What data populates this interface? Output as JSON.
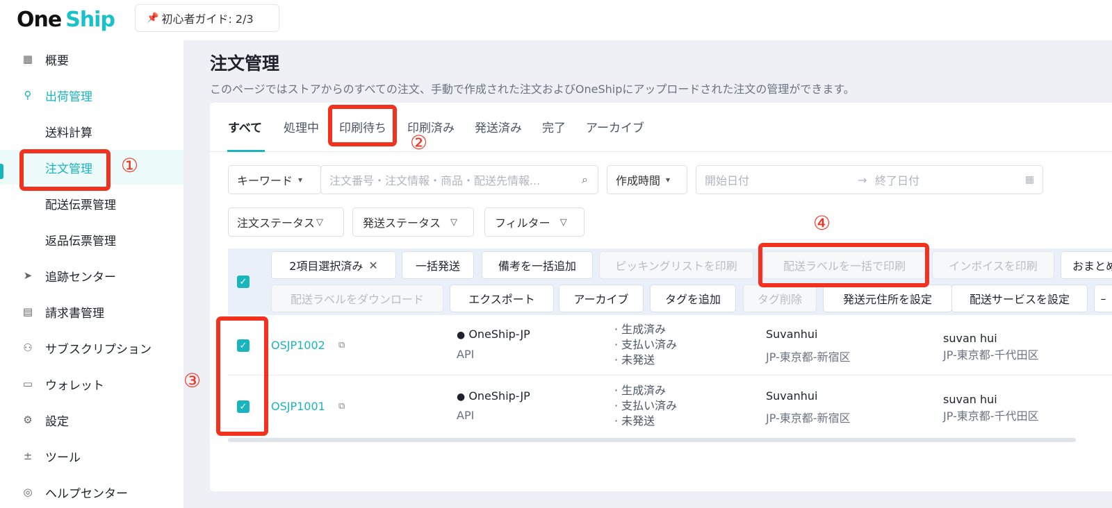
{
  "header": {
    "logo_one": "One",
    "logo_ship": "Ship",
    "guide_label": "初心者ガイド: 2/3"
  },
  "sidebar": {
    "items": [
      {
        "label": "概要",
        "icon": "grid-icon"
      },
      {
        "label": "出荷管理",
        "icon": "shipping-icon"
      },
      {
        "label": "送料計算"
      },
      {
        "label": "注文管理"
      },
      {
        "label": "配送伝票管理"
      },
      {
        "label": "返品伝票管理"
      },
      {
        "label": "追跡センター",
        "icon": "send-icon"
      },
      {
        "label": "請求書管理",
        "icon": "document-icon"
      },
      {
        "label": "サブスクリプション",
        "icon": "user-icon"
      },
      {
        "label": "ウォレット",
        "icon": "wallet-icon"
      },
      {
        "label": "設定",
        "icon": "gear-icon"
      },
      {
        "label": "ツール",
        "icon": "tools-icon"
      },
      {
        "label": "ヘルプセンター",
        "icon": "help-icon"
      }
    ]
  },
  "page": {
    "title": "注文管理",
    "description": "このページではストアからのすべての注文、手動で作成された注文およびOneShipにアップロードされた注文の管理ができます。"
  },
  "tabs": [
    "すべて",
    "処理中",
    "印刷待ち",
    "印刷済み",
    "発送済み",
    "完了",
    "アーカイブ"
  ],
  "filters": {
    "keyword_label": "キーワード",
    "search_placeholder": "注文番号・注文情報・商品・配送先情報...",
    "date_type_label": "作成時間",
    "start_date_placeholder": "開始日付",
    "end_date_placeholder": "終了日付",
    "order_status_label": "注文ステータス",
    "ship_status_label": "発送ステータス",
    "filter_label": "フィルター"
  },
  "bulk_actions": {
    "selected_label": "2項目選択済み",
    "row1": [
      "一括発送",
      "備考を一括追加",
      "ピッキングリストを印刷",
      "配送ラベルを一括で印刷",
      "インボイスを印刷",
      "おまとめ"
    ],
    "row2": [
      "配送ラベルをダウンロード",
      "エクスポート",
      "アーカイブ",
      "タグを追加",
      "タグ削除",
      "発送元住所を設定",
      "配送サービスを設定"
    ]
  },
  "orders": [
    {
      "id": "OSJP1002",
      "store": "OneShip-JP",
      "channel": "API",
      "statuses": [
        "· 生成済み",
        "· 支払い済み",
        "· 未発送"
      ],
      "sender_name": "Suvanhui",
      "sender_area": "JP-東京都-新宿区",
      "recipient_name": "suvan hui",
      "recipient_area": "JP-東京都-千代田区"
    },
    {
      "id": "OSJP1001",
      "store": "OneShip-JP",
      "channel": "API",
      "statuses": [
        "· 生成済み",
        "· 支払い済み",
        "· 未発送"
      ],
      "sender_name": "Suvanhui",
      "sender_area": "JP-東京都-新宿区",
      "recipient_name": "suvan hui",
      "recipient_area": "JP-東京都-千代田区"
    }
  ],
  "annotations": [
    "①",
    "②",
    "③",
    "④"
  ],
  "colors": {
    "accent": "#19b5bd",
    "annotation_red": "#f2311e"
  }
}
